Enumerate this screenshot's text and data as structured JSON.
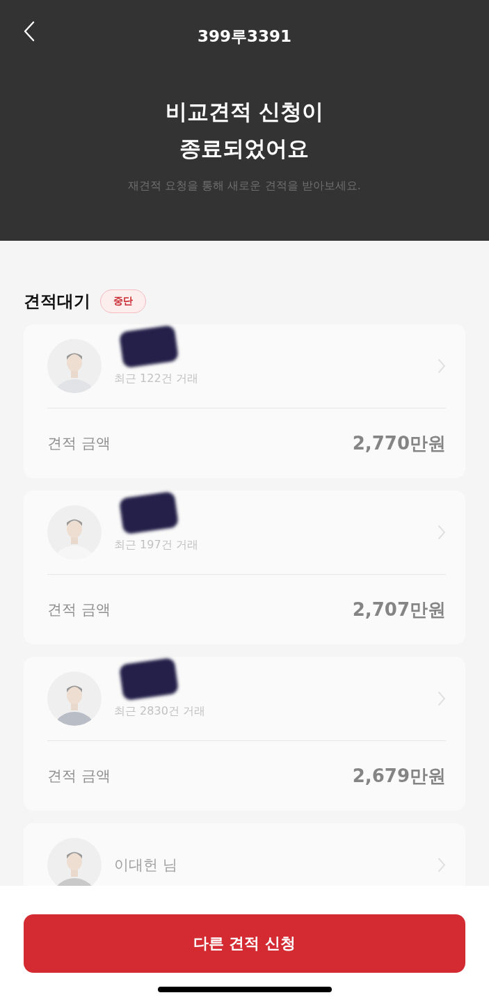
{
  "header": {
    "title": "399루3391",
    "headline": [
      "비교견적 신청이",
      "종료되었어요"
    ],
    "subtitle": "재견적 요청을 통해 새로운 견적을 받아보세요."
  },
  "section": {
    "title": "견적대기",
    "badge": "중단"
  },
  "quotes": [
    {
      "redacted": true,
      "deals": "최근 122건 거래",
      "amount_label": "견적 금액",
      "amount": "2,770만원",
      "disabled": true
    },
    {
      "redacted": true,
      "deals": "최근 197건 거래",
      "amount_label": "견적 금액",
      "amount": "2,707만원",
      "disabled": true
    },
    {
      "redacted": true,
      "deals": "최근 2830건 거래",
      "amount_label": "견적 금액",
      "amount": "2,679만원",
      "disabled": true
    },
    {
      "redacted": false,
      "name": "이대헌 님",
      "disabled": true
    }
  ],
  "button": "다른 견적 신청"
}
